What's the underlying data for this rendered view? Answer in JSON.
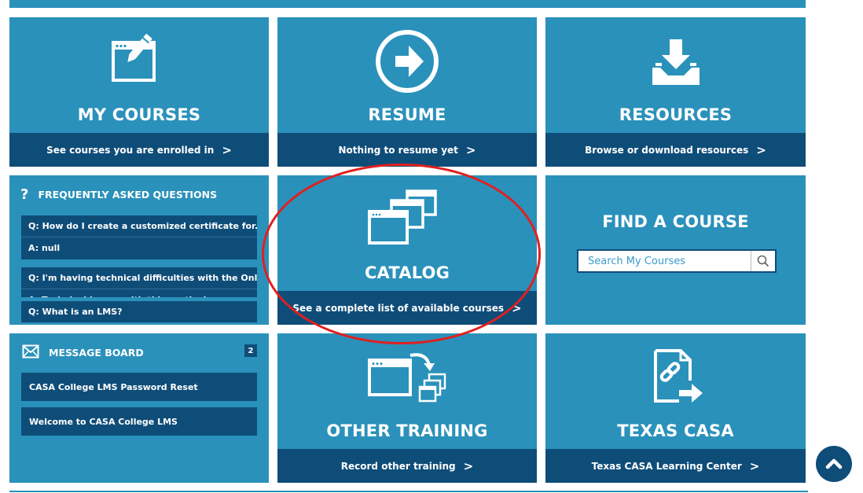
{
  "tiles": {
    "my_courses": {
      "title": "MY COURSES",
      "link": "See courses you are enrolled in"
    },
    "resume": {
      "title": "RESUME",
      "link": "Nothing to resume yet"
    },
    "resources": {
      "title": "RESOURCES",
      "link": "Browse or download resources"
    },
    "catalog": {
      "title": "CATALOG",
      "link": "See a complete list of available courses"
    },
    "find_course": {
      "title": "FIND A COURSE",
      "search_placeholder": "Search My Courses"
    },
    "other_training": {
      "title": "OTHER TRAINING",
      "link": "Record other training"
    },
    "texas_casa": {
      "title": "TEXAS CASA",
      "link": "Texas CASA Learning Center"
    }
  },
  "faq": {
    "icon": "question-mark-icon",
    "title": "FREQUENTLY ASKED QUESTIONS",
    "items": [
      {
        "q": "Q: How do I create a customized certificate for...",
        "a": "A: null"
      },
      {
        "q": "Q: I'm having technical difficulties with the Onl...",
        "a": "A: Technical issues with this particul..."
      },
      {
        "q": "Q: What is an LMS?"
      }
    ]
  },
  "message_board": {
    "icon": "envelope-icon",
    "title": "MESSAGE BOARD",
    "count": "2",
    "messages": [
      "CASA College LMS Password Reset",
      "Welcome to CASA College LMS"
    ]
  },
  "chevron": ">",
  "colors": {
    "tile": "#2a91bb",
    "footer": "#0f4d79",
    "annotation": "#e02020"
  }
}
